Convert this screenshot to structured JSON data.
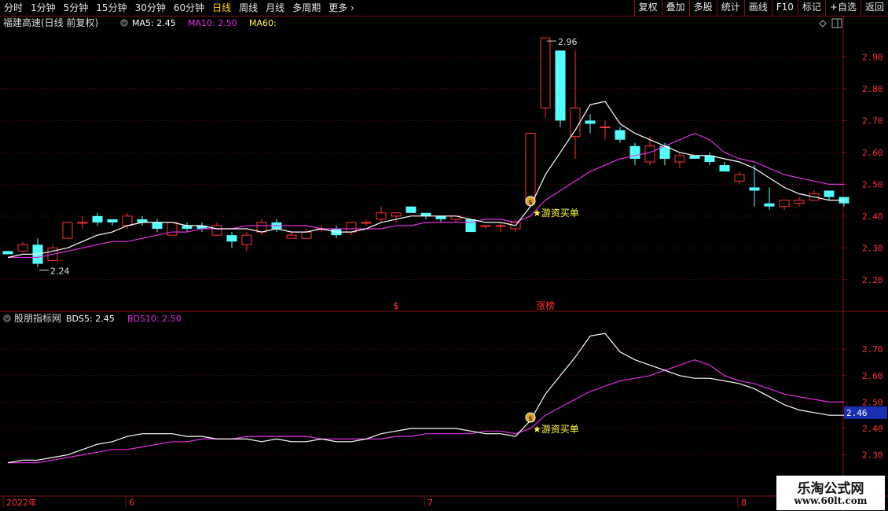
{
  "toolbar": {
    "periods": [
      "分时",
      "1分钟",
      "5分钟",
      "15分钟",
      "30分钟",
      "60分钟",
      "日线",
      "周线",
      "月线",
      "多周期",
      "更多 ›"
    ],
    "active_period": "日线",
    "buttons": [
      "复权",
      "叠加",
      "多股",
      "统计",
      "画线",
      "F10",
      "标记",
      "+自选",
      "返回"
    ]
  },
  "colors": {
    "up": "#ff3232",
    "down": "#54ffff",
    "ma5": "#ffffff",
    "ma10": "#e030e0",
    "ma60": "#ffff40",
    "grid": "#7a1414",
    "axis_text": "#ff3232",
    "annotation": "#ffff40"
  },
  "chart_data": [
    {
      "type": "candlestick",
      "title": "福建高速(日线 前复权)",
      "legend": [
        {
          "key": "ma5",
          "label": "MA5: 2.45"
        },
        {
          "key": "ma10",
          "label": "MA10: 2.50"
        },
        {
          "key": "ma60",
          "label": "MA60:"
        }
      ],
      "ylim": [
        2.16,
        2.99
      ],
      "yticks": [
        "2.20",
        "2.30",
        "2.40",
        "2.50",
        "2.60",
        "2.70",
        "2.80",
        "2.90"
      ],
      "xticks": [
        {
          "index": 0,
          "label": "2022年"
        },
        {
          "index": 8,
          "label": "6"
        },
        {
          "index": 28,
          "label": "7"
        },
        {
          "index": 49,
          "label": "8"
        }
      ],
      "ohlc": [
        [
          2.29,
          2.29,
          2.28,
          2.28
        ],
        [
          2.29,
          2.32,
          2.29,
          2.31
        ],
        [
          2.31,
          2.33,
          2.24,
          2.25
        ],
        [
          2.26,
          2.31,
          2.26,
          2.3
        ],
        [
          2.33,
          2.38,
          2.33,
          2.38
        ],
        [
          2.38,
          2.4,
          2.36,
          2.38
        ],
        [
          2.4,
          2.41,
          2.37,
          2.38
        ],
        [
          2.39,
          2.39,
          2.37,
          2.38
        ],
        [
          2.37,
          2.41,
          2.36,
          2.4
        ],
        [
          2.39,
          2.4,
          2.37,
          2.38
        ],
        [
          2.38,
          2.39,
          2.35,
          2.36
        ],
        [
          2.34,
          2.38,
          2.34,
          2.38
        ],
        [
          2.37,
          2.38,
          2.35,
          2.36
        ],
        [
          2.37,
          2.38,
          2.35,
          2.36
        ],
        [
          2.34,
          2.38,
          2.34,
          2.37
        ],
        [
          2.34,
          2.35,
          2.3,
          2.32
        ],
        [
          2.31,
          2.35,
          2.29,
          2.34
        ],
        [
          2.35,
          2.39,
          2.34,
          2.38
        ],
        [
          2.38,
          2.39,
          2.35,
          2.36
        ],
        [
          2.33,
          2.35,
          2.33,
          2.34
        ],
        [
          2.33,
          2.36,
          2.33,
          2.35
        ],
        [
          2.36,
          2.37,
          2.35,
          2.36
        ],
        [
          2.36,
          2.37,
          2.33,
          2.34
        ],
        [
          2.35,
          2.38,
          2.34,
          2.38
        ],
        [
          2.38,
          2.39,
          2.37,
          2.38
        ],
        [
          2.39,
          2.43,
          2.38,
          2.41
        ],
        [
          2.4,
          2.41,
          2.38,
          2.41
        ],
        [
          2.43,
          2.43,
          2.41,
          2.41
        ],
        [
          2.41,
          2.41,
          2.39,
          2.4
        ],
        [
          2.4,
          2.4,
          2.38,
          2.39
        ],
        [
          2.39,
          2.4,
          2.38,
          2.4
        ],
        [
          2.39,
          2.39,
          2.35,
          2.35
        ],
        [
          2.37,
          2.37,
          2.36,
          2.37
        ],
        [
          2.37,
          2.38,
          2.35,
          2.37
        ],
        [
          2.36,
          2.39,
          2.35,
          2.38
        ],
        [
          2.45,
          2.66,
          2.45,
          2.66
        ],
        [
          2.74,
          2.96,
          2.71,
          2.96
        ],
        [
          2.92,
          2.92,
          2.68,
          2.7
        ],
        [
          2.65,
          2.92,
          2.58,
          2.74
        ],
        [
          2.7,
          2.72,
          2.66,
          2.69
        ],
        [
          2.68,
          2.7,
          2.64,
          2.68
        ],
        [
          2.67,
          2.68,
          2.63,
          2.64
        ],
        [
          2.62,
          2.63,
          2.56,
          2.58
        ],
        [
          2.57,
          2.65,
          2.56,
          2.62
        ],
        [
          2.62,
          2.63,
          2.56,
          2.58
        ],
        [
          2.57,
          2.6,
          2.55,
          2.59
        ],
        [
          2.59,
          2.59,
          2.58,
          2.58
        ],
        [
          2.59,
          2.6,
          2.56,
          2.57
        ],
        [
          2.56,
          2.57,
          2.54,
          2.54
        ],
        [
          2.51,
          2.54,
          2.5,
          2.53
        ],
        [
          2.49,
          2.56,
          2.43,
          2.48
        ],
        [
          2.44,
          2.49,
          2.42,
          2.43
        ],
        [
          2.43,
          2.45,
          2.42,
          2.45
        ],
        [
          2.44,
          2.46,
          2.43,
          2.45
        ],
        [
          2.45,
          2.48,
          2.45,
          2.47
        ],
        [
          2.48,
          2.48,
          2.45,
          2.46
        ],
        [
          2.46,
          2.46,
          2.43,
          2.44
        ]
      ],
      "ma5": [
        2.27,
        2.28,
        2.28,
        2.29,
        2.3,
        2.32,
        2.34,
        2.35,
        2.37,
        2.38,
        2.38,
        2.38,
        2.37,
        2.37,
        2.36,
        2.36,
        2.36,
        2.35,
        2.36,
        2.35,
        2.35,
        2.36,
        2.35,
        2.35,
        2.36,
        2.38,
        2.39,
        2.4,
        2.4,
        2.4,
        2.4,
        2.39,
        2.38,
        2.38,
        2.37,
        2.43,
        2.53,
        2.6,
        2.67,
        2.75,
        2.76,
        2.69,
        2.66,
        2.64,
        2.62,
        2.6,
        2.59,
        2.59,
        2.58,
        2.57,
        2.55,
        2.52,
        2.49,
        2.47,
        2.46,
        2.45,
        2.45
      ],
      "ma10": [
        2.27,
        2.27,
        2.27,
        2.28,
        2.29,
        2.3,
        2.31,
        2.32,
        2.32,
        2.33,
        2.34,
        2.35,
        2.35,
        2.36,
        2.36,
        2.36,
        2.37,
        2.37,
        2.37,
        2.37,
        2.37,
        2.36,
        2.36,
        2.36,
        2.36,
        2.36,
        2.37,
        2.37,
        2.38,
        2.38,
        2.38,
        2.38,
        2.39,
        2.39,
        2.38,
        2.4,
        2.45,
        2.48,
        2.51,
        2.54,
        2.56,
        2.58,
        2.59,
        2.6,
        2.62,
        2.64,
        2.66,
        2.64,
        2.6,
        2.58,
        2.57,
        2.55,
        2.53,
        2.52,
        2.51,
        2.5,
        2.5
      ],
      "annotations": [
        {
          "index": 36,
          "price": 2.96,
          "text": "2.96"
        },
        {
          "index": 2,
          "price": 2.24,
          "text": "2.24"
        },
        {
          "index": 35,
          "price": 2.41,
          "text": "★游资买单"
        }
      ],
      "bottom_markers": [
        {
          "index": 26,
          "text": "$"
        },
        {
          "index": 36,
          "text": "涨榜"
        }
      ]
    },
    {
      "type": "line",
      "title": "股朋指标网",
      "legend": [
        {
          "key": "ma5",
          "label": "BDS5: 2.45"
        },
        {
          "key": "ma10",
          "label": "BDS10: 2.50"
        }
      ],
      "ylim": [
        2.26,
        2.79
      ],
      "yticks": [
        "2.30",
        "2.40",
        "2.50",
        "2.60",
        "2.70"
      ],
      "current_value": "2.46",
      "current_value_at": 2.46,
      "annotation": {
        "index": 35,
        "value": 2.4,
        "text": "★游资买单"
      }
    }
  ],
  "watermark": {
    "title": "乐淘公式网",
    "url": "www.60lt.com"
  }
}
